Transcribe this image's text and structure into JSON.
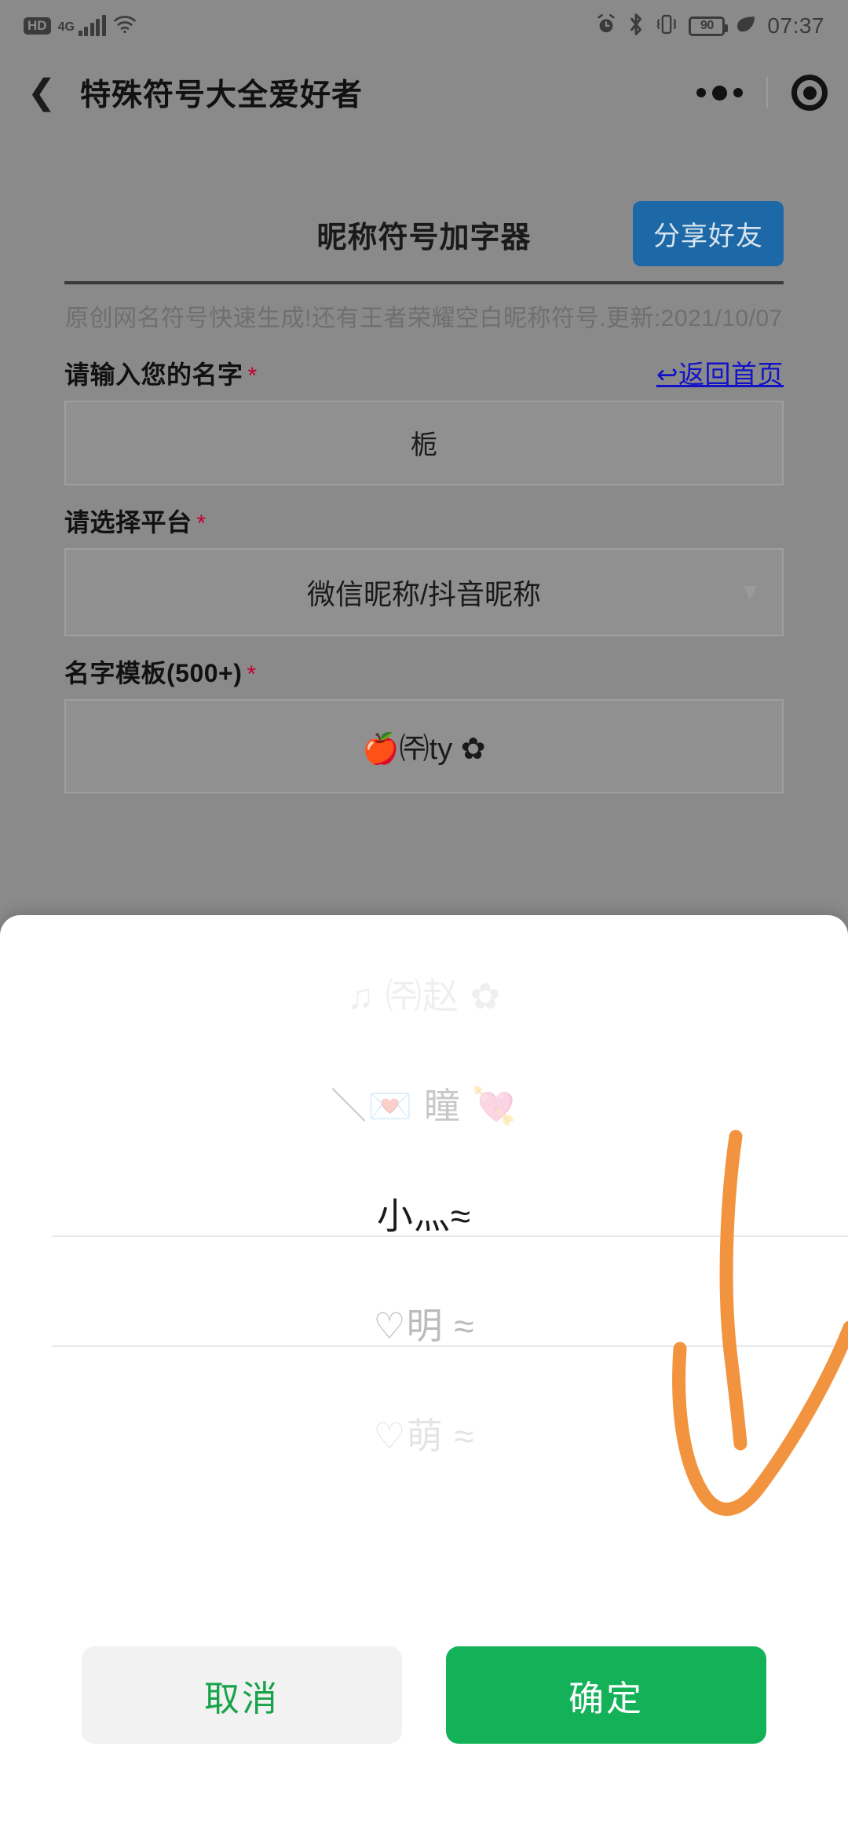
{
  "status_bar": {
    "hd_badge": "HD",
    "network_type": "4G",
    "icons": [
      "signal-bars-icon",
      "wifi-icon",
      "alarm-icon",
      "bluetooth-icon",
      "vibrate-icon"
    ],
    "battery_percent": "90",
    "power_saving_icon": "leaf-icon",
    "time": "07:37"
  },
  "navbar": {
    "back_icon": "back-chevron-icon",
    "title": "特殊符号大全爱好者",
    "more_icon": "more-dots-icon",
    "target_icon": "capsule-target-icon"
  },
  "page": {
    "heading": "昵称符号加字器",
    "share_button": "分享好友",
    "description": "原创网名符号快速生成!还有王者荣耀空白昵称符号.更新:2021/10/07",
    "fields": [
      {
        "label": "请输入您的名字",
        "required_mark": "*",
        "value": "栀",
        "placeholder": "请输入您的名字"
      },
      {
        "label": "请选择平台",
        "required_mark": "*",
        "value": "微信昵称/抖音昵称",
        "chevron": "▼"
      },
      {
        "label": "名字模板(500+)",
        "required_mark": "*",
        "value": "🍎㈜ty ✿"
      }
    ],
    "home_link": "↩返回首页"
  },
  "sheet": {
    "options": [
      "♫ ㈜赵 ✿",
      "＼💌 瞳 💘",
      "小灬≈",
      "♡明 ≈",
      "♡萌 ≈"
    ],
    "selected_index": 2,
    "cancel_button": "取消",
    "confirm_button": "确定"
  },
  "annotation": {
    "name": "orange-check-mark",
    "color": "#f2943f"
  },
  "colors": {
    "share_blue": "#1d68a7",
    "confirm_green": "#13b259",
    "cancel_text_green": "#17a34a",
    "link_blue": "#1212c8",
    "required_red": "#c2002f",
    "page_dim": "#8a8a8a"
  }
}
